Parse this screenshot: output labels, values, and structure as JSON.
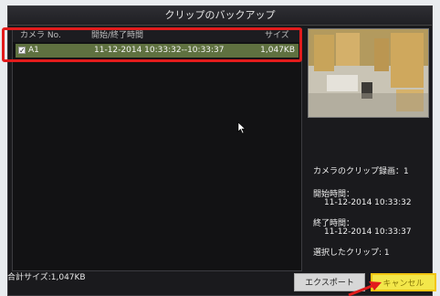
{
  "dialog": {
    "title": "クリップのバックアップ"
  },
  "list": {
    "headers": {
      "camera": "カメラ No.",
      "time": "開始/終了時間",
      "size": "サイズ"
    },
    "rows": [
      {
        "checked": true,
        "camera": "A1",
        "time": "11-12-2014 10:33:32--10:33:37",
        "size": "1,047KB"
      }
    ]
  },
  "info": {
    "clip_count_label": "カメラのクリップ録画：1",
    "start_label": "開始時間：",
    "start_value": "11-12-2014 10:33:32",
    "end_label": "終了時間：",
    "end_value": "11-12-2014 10:33:37",
    "selected_label": "選択したクリップ: 1"
  },
  "footer": {
    "total_size": "合計サイズ:1,047KB",
    "export_label": "エクスポート",
    "cancel_label": "キャンセル"
  },
  "colors": {
    "row_selected": "#5f7140",
    "highlight_box": "#e21c1c",
    "cancel_button": "#f3e74a"
  }
}
